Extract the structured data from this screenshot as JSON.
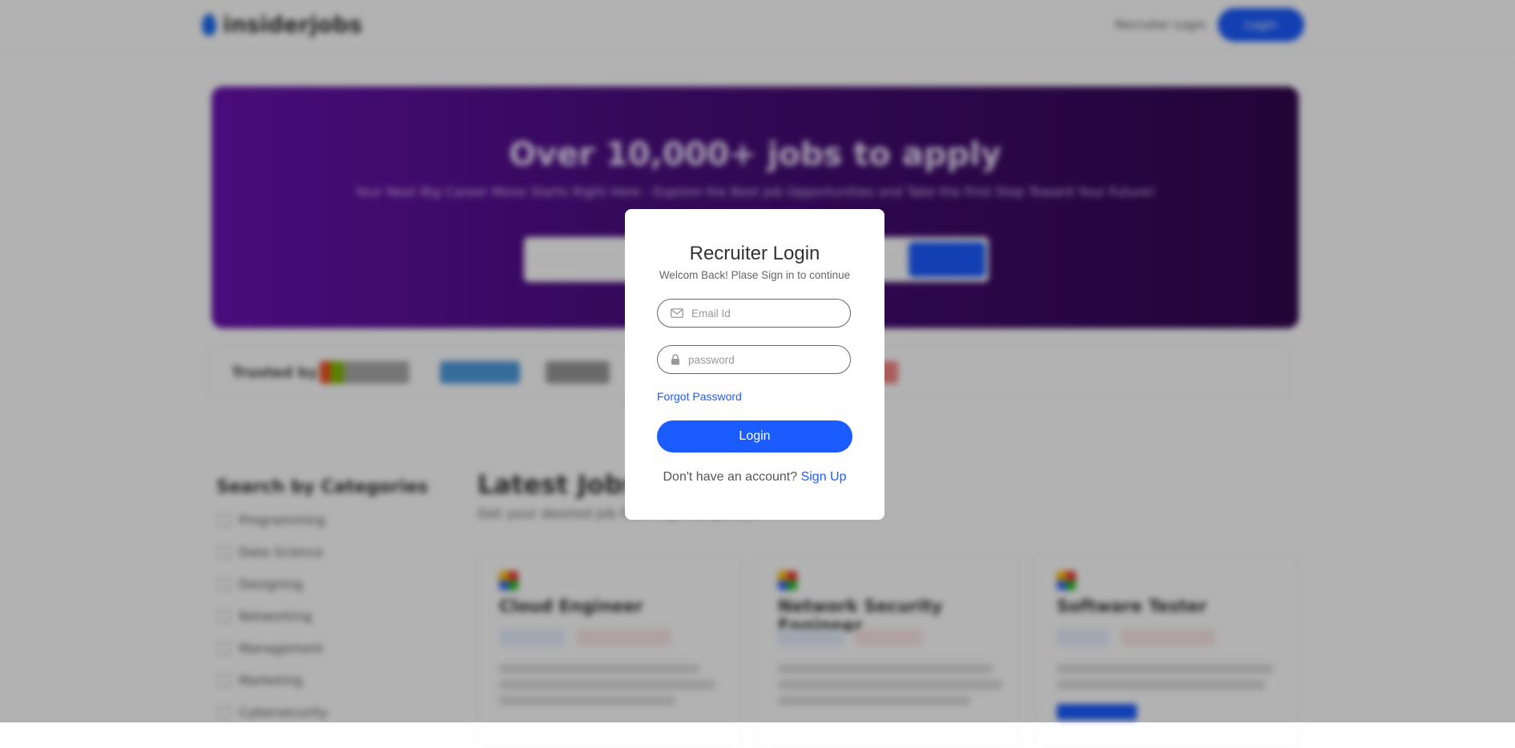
{
  "background": {
    "logo_text": "insiderjobs",
    "nav": {
      "recruiter_label": "Recruiter Login",
      "login_label": "Login"
    },
    "hero": {
      "title": "Over 10,000+ jobs to apply",
      "subtitle": "Your Next Big Career Move Starts Right Here - Explore the Best Job Opportunities and Take the First Step Toward Your Future!"
    },
    "trusted_label": "Trusted by",
    "categories_title": "Search by Categories",
    "categories": [
      "Programming",
      "Data Science",
      "Designing",
      "Networking",
      "Management",
      "Marketing",
      "Cybersecurity"
    ],
    "latest_jobs_title": "Latest Jobs",
    "latest_jobs_subtitle": "Get your desired job from top companies",
    "job_cards": [
      {
        "title": "Cloud Engineer"
      },
      {
        "title": "Network Security Engineer"
      },
      {
        "title": "Software Tester"
      }
    ]
  },
  "modal": {
    "title": "Recruiter Login",
    "subtitle": "Welcom Back! Plase Sign in to continue",
    "email_placeholder": "Email Id",
    "password_placeholder": "password",
    "forgot_label": "Forgot Password",
    "login_label": "Login",
    "no_account_text": "Don't have an account? ",
    "signup_label": "Sign Up"
  },
  "colors": {
    "accent": "#1a5cff",
    "hero_start": "#6a12b0",
    "hero_end": "#32064f"
  }
}
